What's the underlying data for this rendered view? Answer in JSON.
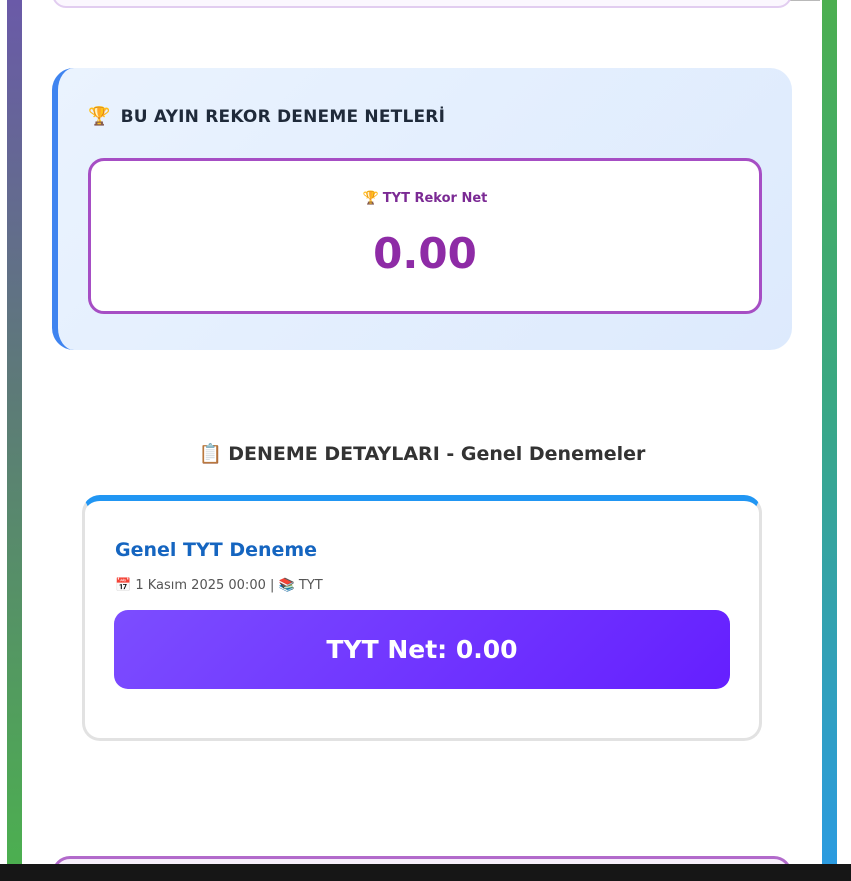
{
  "colors": {
    "rekor_accent": "#3f84f0",
    "rekor_box_border": "#a64ec4",
    "rekor_value": "#8e2ba6",
    "card_top_border": "#2196f3",
    "card_title": "#1565c0",
    "net_bar_start": "#7c4dff",
    "net_bar_end": "#651fff"
  },
  "rekor": {
    "title_icon": "🏆",
    "icon_name": "trophy-icon",
    "title": "BU AYIN REKOR DENEME NETLERİ",
    "box": {
      "label_icon": "🏆",
      "label": "TYT Rekor Net",
      "value": "0.00"
    }
  },
  "details": {
    "heading_icon": "📋",
    "icon_name": "clipboard-icon",
    "heading": "DENEME DETAYLARI - Genel Denemeler",
    "exams": [
      {
        "title": "Genel TYT Deneme",
        "date_icon": "📅",
        "date": "1 Kasım 2025 00:00",
        "separator": "|",
        "type_icon": "📚",
        "type": "TYT",
        "net_text": "TYT Net: 0.00"
      }
    ]
  }
}
